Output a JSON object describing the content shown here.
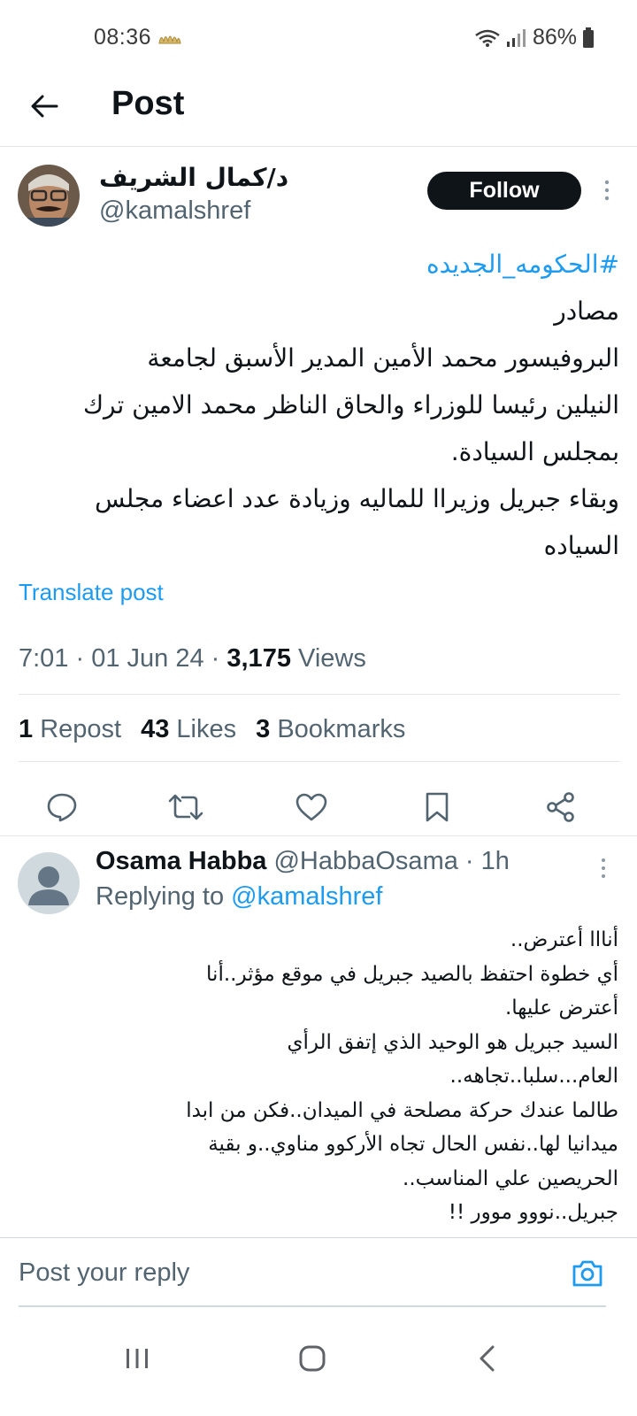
{
  "status_bar": {
    "time": "08:36",
    "battery": "86%",
    "icons": [
      "religious-emblem-icon",
      "wifi-icon",
      "signal-icon",
      "battery-icon"
    ]
  },
  "header": {
    "title": "Post",
    "back_icon": "back-arrow-icon"
  },
  "post": {
    "author_name": "د/كمال الشريف",
    "author_handle": "@kamalshref",
    "follow_label": "Follow",
    "hashtag": "#الحكومه_الجديده",
    "body_lines": [
      "مصادر",
      "البروفيسور محمد الأمين المدير الأسبق لجامعة",
      "النيلين رئيسا للوزراء والحاق الناظر محمد الامين ترك",
      "بمجلس السيادة.",
      "وبقاء جبريل وزيراا للماليه وزيادة عدد اعضاء مجلس",
      "السياده"
    ],
    "translate_label": "Translate post",
    "timestamp": "7:01 · 01 Jun 24 · ",
    "views_count": "3,175",
    "views_label": " Views",
    "stats": {
      "reposts_count": "1",
      "reposts_label": "Repost",
      "likes_count": "43",
      "likes_label": "Likes",
      "bookmarks_count": "3",
      "bookmarks_label": "Bookmarks"
    },
    "action_icons": [
      "reply-icon",
      "repost-icon",
      "like-icon",
      "bookmark-icon",
      "share-icon"
    ]
  },
  "reply": {
    "name": "Osama Habba",
    "handle": "@HabbaOsama · 1h",
    "replying_prefix": "Replying to ",
    "replying_to": "@kamalshref",
    "body_lines": [
      "أنااا أعترض..",
      "أي خطوة احتفظ بالصيد جبريل في موقع مؤثر..أنا",
      "أعترض عليها.",
      "السيد جبريل هو الوحيد الذي إتفق الرأي",
      "العام...سلبا..تجاهه..",
      "طالما عندك حركة مصلحة في الميدان..فكن من ابدا",
      "ميدانيا لها..نفس الحال تجاه الأركوو مناوي..و بقية",
      "الحريصين علي المناسب..",
      "جبريل..نووو موور !!"
    ]
  },
  "composer": {
    "placeholder": "Post your reply"
  },
  "navbar": {
    "icons": [
      "recent-apps-icon",
      "home-icon",
      "back-icon"
    ]
  },
  "colors": {
    "accent": "#1d9bf0",
    "text_primary": "#0f1419",
    "text_secondary": "#536471",
    "follow_bg": "#0f1419"
  }
}
